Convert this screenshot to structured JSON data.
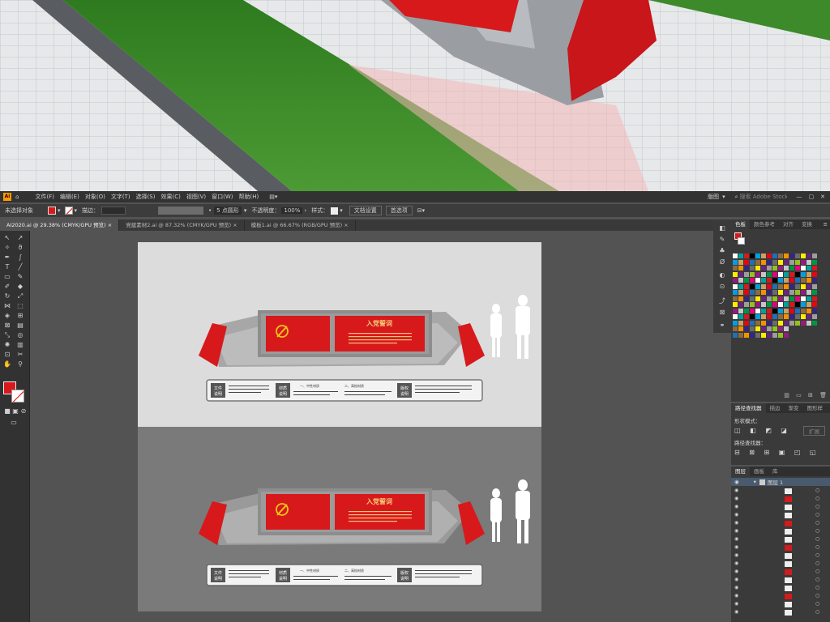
{
  "app": {
    "menus": [
      "文件(F)",
      "编辑(E)",
      "对象(O)",
      "文字(T)",
      "选择(S)",
      "效果(C)",
      "视图(V)",
      "窗口(W)",
      "帮助(H)"
    ],
    "workspace": "版图",
    "search_placeholder": "搜索 Adobe Stock"
  },
  "controlbar": {
    "selection_label": "未选择对象",
    "stroke_label": "描边：",
    "brush_label": "5 点圆形",
    "opacity_label": "不透明度：",
    "opacity_value": "100%",
    "style_label": "样式：",
    "doc_setup_button": "文档设置",
    "preferences_button": "首选项"
  },
  "tabs": [
    {
      "label": "AI2020.ai @ 29.38% (CMYK/GPU 预览)",
      "active": true
    },
    {
      "label": "党建素材2.ai @ 87.32% (CMYK/GPU 预览)",
      "active": false
    },
    {
      "label": "模板1.ai @ 66.67% (RGB/GPU 预览)",
      "active": false
    }
  ],
  "artwork": {
    "banner_title": "入党誓词",
    "info_boxes": [
      {
        "label1": "文件",
        "label2": "说明"
      },
      {
        "label1": "材质",
        "label2": "说明"
      },
      {
        "label1": "版权",
        "label2": "说明"
      }
    ],
    "column_heads": [
      "一、中性材质",
      "二、高档材质"
    ]
  },
  "swatches_panel": {
    "tabs": [
      "色板",
      "颜色参考",
      "对齐",
      "变换"
    ]
  },
  "pathfinder_panel": {
    "tabs": [
      "路径查找器",
      "描边",
      "渐变",
      "图形样"
    ],
    "shape_modes_label": "形状模式：",
    "pathfinders_label": "路径查找器：",
    "expand_button": "扩展"
  },
  "layers_panel": {
    "tabs": [
      "图层",
      "画板",
      "库"
    ],
    "layer_name": "图层 1"
  },
  "colors": {
    "party_red": "#d7191c",
    "ui_dark": "#323232",
    "ui_mid": "#535353",
    "grass": "#3d8a2a"
  }
}
